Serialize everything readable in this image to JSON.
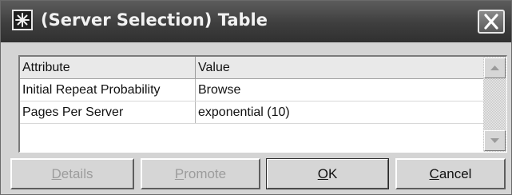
{
  "window": {
    "title": "(Server Selection) Table",
    "close_label": "×"
  },
  "table": {
    "columns": [
      "Attribute",
      "Value"
    ],
    "rows": [
      [
        "Initial Repeat Probability",
        "Browse"
      ],
      [
        "Pages Per Server",
        "exponential (10)"
      ]
    ]
  },
  "buttons": {
    "details": {
      "mnemonic": "D",
      "rest": "etails",
      "enabled": false
    },
    "promote": {
      "mnemonic": "P",
      "rest": "romote",
      "enabled": false
    },
    "ok": {
      "mnemonic": "O",
      "rest": "K",
      "enabled": true
    },
    "cancel": {
      "mnemonic": "C",
      "rest": "ancel",
      "enabled": true
    }
  },
  "icons": {
    "title": "asterisk-app-icon",
    "close": "close-icon",
    "scroll_up": "scroll-up-arrow-icon",
    "scroll_down": "scroll-down-arrow-icon"
  }
}
